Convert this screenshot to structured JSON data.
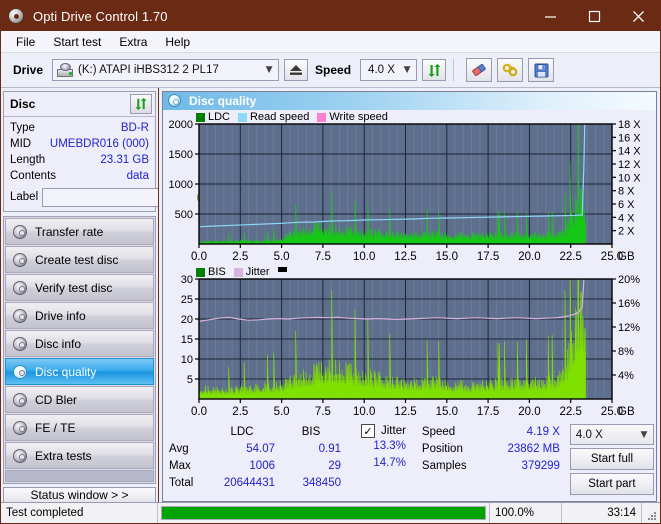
{
  "window": {
    "title": "Opti Drive Control 1.70",
    "title_icon": "disc-icon",
    "minimize": "–",
    "maximize": "□",
    "close": "✕",
    "titlebar_color": "#6b2a14"
  },
  "menu": {
    "items": [
      {
        "label": "File"
      },
      {
        "label": "Start test"
      },
      {
        "label": "Extra"
      },
      {
        "label": "Help"
      }
    ]
  },
  "toolbar": {
    "drive_label": "Drive",
    "drive_value": "(K:)  ATAPI iHBS312  2 PL17",
    "eject_icon": "eject-icon",
    "speed_label": "Speed",
    "speed_value": "4.0 X",
    "refresh_icon": "refresh-icon",
    "eraser_icon": "eraser-icon",
    "keys_icon": "keys-icon",
    "save_icon": "save-icon"
  },
  "disc_panel": {
    "header": "Disc",
    "refresh_icon": "refresh-icon",
    "rows": [
      {
        "key": "Type",
        "value": "BD-R"
      },
      {
        "key": "MID",
        "value": "UMEBDR016 (000)"
      },
      {
        "key": "Length",
        "value": "23.31 GB"
      },
      {
        "key": "Contents",
        "value": "data"
      }
    ],
    "label_key": "Label",
    "label_value": "",
    "label_placeholder": "",
    "disc_button_icon": "cd-icon"
  },
  "nav": {
    "items": [
      {
        "label": "Transfer rate",
        "icon": "disc-icon",
        "active": false
      },
      {
        "label": "Create test disc",
        "icon": "disc-icon",
        "active": false
      },
      {
        "label": "Verify test disc",
        "icon": "disc-icon",
        "active": false
      },
      {
        "label": "Drive info",
        "icon": "disc-icon",
        "active": false
      },
      {
        "label": "Disc info",
        "icon": "disc-icon",
        "active": false
      },
      {
        "label": "Disc quality",
        "icon": "disc-icon",
        "active": true
      },
      {
        "label": "CD Bler",
        "icon": "disc-icon",
        "active": false
      },
      {
        "label": "FE / TE",
        "icon": "disc-icon",
        "active": false
      },
      {
        "label": "Extra tests",
        "icon": "disc-icon",
        "active": false
      }
    ],
    "status_window_button": "Status window > >"
  },
  "main": {
    "panel_title": "Disc quality",
    "panel_icon": "disc-icon"
  },
  "stats": {
    "col_headers": [
      "LDC",
      "BIS"
    ],
    "row_labels": [
      "Avg",
      "Max",
      "Total"
    ],
    "ldc": {
      "avg": "54.07",
      "max": "1006",
      "total": "20644431"
    },
    "bis": {
      "avg": "0.91",
      "max": "29",
      "total": "348450"
    },
    "jitter": {
      "checkbox_label": "Jitter",
      "checked": true,
      "check_glyph": "✓",
      "avg": "13.3%",
      "max": "14.7%"
    },
    "speed_key": "Speed",
    "speed_value": "4.19 X",
    "position_key": "Position",
    "position_value": "23862 MB",
    "samples_key": "Samples",
    "samples_value": "379299",
    "speed_select": "4.0 X",
    "start_full_button": "Start full",
    "start_part_button": "Start part"
  },
  "statusbar": {
    "message": "Test completed",
    "progress_percent": 100.0,
    "progress_text": "100.0%",
    "elapsed": "33:14",
    "progress_color": "#00a400"
  },
  "chart_data": [
    {
      "id": "ldc-chart",
      "type": "area",
      "title": "",
      "xlabel": "GB",
      "ylabel": "",
      "xlim": [
        0,
        25.0
      ],
      "xticks": [
        "0.0",
        "2.5",
        "5.0",
        "7.5",
        "10.0",
        "12.5",
        "15.0",
        "17.5",
        "20.0",
        "22.5",
        "25.0"
      ],
      "xtick_values": [
        0,
        2.5,
        5,
        7.5,
        10,
        12.5,
        15,
        17.5,
        20,
        22.5,
        25
      ],
      "x_unit": "GB",
      "ylim": [
        0,
        2000
      ],
      "yticks": [
        "500",
        "1000",
        "1500",
        "2000"
      ],
      "ytick_values": [
        500,
        1000,
        1500,
        2000
      ],
      "y2lim": [
        0,
        18
      ],
      "y2ticks": [
        "2 X",
        "4 X",
        "6 X",
        "8 X",
        "10 X",
        "12 X",
        "14 X",
        "16 X",
        "18 X"
      ],
      "y2tick_values": [
        2,
        4,
        6,
        8,
        10,
        12,
        14,
        16,
        18
      ],
      "grid": true,
      "plot_bg": "#5e6f8e",
      "legend_position": "top-left",
      "legend": [
        {
          "name": "LDC",
          "color": "#008000"
        },
        {
          "name": "Read speed",
          "color": "#8ed8f8"
        },
        {
          "name": "Write speed",
          "color": "#ff7fd4"
        }
      ],
      "series": [
        {
          "name": "LDC",
          "color": "#16c816",
          "kind": "area",
          "x": [
            0.0,
            0.4,
            0.8,
            1.2,
            1.7,
            2.1,
            2.5,
            3.0,
            3.4,
            3.8,
            4.2,
            4.6,
            5.0,
            5.2,
            5.5,
            5.9,
            6.3,
            6.7,
            7.1,
            7.5,
            7.9,
            8.3,
            8.7,
            9.1,
            9.5,
            9.9,
            10.3,
            10.7,
            11.1,
            11.5,
            11.9,
            12.3,
            12.7,
            13.1,
            13.5,
            13.9,
            14.3,
            14.7,
            15.1,
            15.5,
            15.9,
            16.3,
            16.7,
            17.1,
            17.5,
            17.9,
            18.3,
            18.7,
            19.1,
            19.5,
            19.9,
            20.3,
            20.7,
            21.1,
            21.5,
            21.9,
            22.1,
            22.3,
            22.5,
            22.7,
            22.9,
            23.1,
            23.3,
            23.4
          ],
          "values": [
            60,
            55,
            62,
            58,
            65,
            60,
            70,
            68,
            72,
            75,
            80,
            88,
            95,
            150,
            200,
            250,
            290,
            330,
            360,
            345,
            330,
            320,
            300,
            285,
            270,
            260,
            250,
            240,
            235,
            230,
            225,
            220,
            218,
            215,
            212,
            210,
            208,
            206,
            205,
            203,
            202,
            200,
            200,
            198,
            197,
            196,
            195,
            195,
            194,
            193,
            193,
            192,
            192,
            195,
            200,
            230,
            280,
            380,
            520,
            700,
            880,
            990,
            1006,
            600
          ]
        },
        {
          "name": "Read speed",
          "color": "#8ed8f8",
          "kind": "line",
          "x": [
            0.0,
            1.0,
            2.0,
            3.0,
            4.0,
            5.0,
            6.0,
            7.0,
            8.0,
            9.0,
            10.0,
            11.0,
            12.0,
            13.0,
            14.0,
            15.0,
            16.0,
            17.0,
            18.0,
            19.0,
            20.0,
            21.0,
            22.0,
            22.8,
            23.2,
            23.3,
            23.35
          ],
          "values": [
            2.6,
            2.7,
            2.8,
            2.9,
            3.0,
            3.1,
            3.25,
            3.3,
            3.45,
            3.5,
            3.6,
            3.65,
            3.7,
            3.75,
            3.85,
            3.9,
            3.95,
            4.0,
            4.05,
            4.1,
            4.15,
            4.2,
            4.25,
            4.3,
            4.35,
            12.0,
            18.0
          ]
        },
        {
          "name": "Write speed",
          "color": "#ff7fd4",
          "kind": "line",
          "x": [],
          "values": []
        }
      ]
    },
    {
      "id": "bis-jitter-chart",
      "type": "area",
      "title": "",
      "xlabel": "GB",
      "ylabel": "",
      "xlim": [
        0,
        25.0
      ],
      "xticks": [
        "0.0",
        "2.5",
        "5.0",
        "7.5",
        "10.0",
        "12.5",
        "15.0",
        "17.5",
        "20.0",
        "22.5",
        "25.0"
      ],
      "xtick_values": [
        0,
        2.5,
        5,
        7.5,
        10,
        12.5,
        15,
        17.5,
        20,
        22.5,
        25
      ],
      "x_unit": "GB",
      "ylim": [
        0,
        30
      ],
      "yticks": [
        "5",
        "10",
        "15",
        "20",
        "25",
        "30"
      ],
      "ytick_values": [
        5,
        10,
        15,
        20,
        25,
        30
      ],
      "y2lim": [
        0,
        20
      ],
      "y2ticks": [
        "4%",
        "8%",
        "12%",
        "16%",
        "20%"
      ],
      "y2tick_values": [
        4,
        8,
        12,
        16,
        20
      ],
      "grid": true,
      "plot_bg": "#5e6f8e",
      "legend_position": "top-left",
      "legend": [
        {
          "name": "BIS",
          "color": "#008000"
        },
        {
          "name": "Jitter",
          "color": "#d9b3e0"
        },
        {
          "name": "marker",
          "color": "#000000"
        }
      ],
      "series": [
        {
          "name": "BIS",
          "color": "#7fe000",
          "kind": "area",
          "x": [
            0.0,
            0.5,
            1.0,
            1.5,
            2.0,
            2.5,
            3.0,
            3.5,
            4.0,
            4.5,
            5.0,
            5.5,
            6.0,
            6.5,
            7.0,
            7.5,
            8.0,
            8.5,
            9.0,
            9.5,
            10.0,
            10.5,
            11.0,
            11.5,
            12.0,
            12.5,
            13.0,
            13.5,
            14.0,
            14.5,
            15.0,
            15.5,
            16.0,
            16.5,
            17.0,
            17.5,
            18.0,
            18.5,
            19.0,
            19.5,
            20.0,
            20.5,
            21.0,
            21.5,
            21.9,
            22.1,
            22.3,
            22.5,
            22.7,
            22.9,
            23.05,
            23.2,
            23.3,
            23.4
          ],
          "values": [
            3.0,
            3.2,
            3.0,
            2.8,
            3.0,
            3.2,
            3.5,
            3.8,
            4.0,
            4.2,
            4.5,
            5.5,
            6.5,
            7.5,
            8.5,
            9.5,
            10.0,
            9.8,
            9.0,
            8.0,
            7.5,
            7.0,
            6.5,
            6.0,
            5.8,
            5.5,
            5.3,
            5.2,
            5.5,
            5.3,
            5.0,
            4.8,
            4.5,
            4.3,
            4.5,
            4.8,
            5.0,
            5.2,
            5.0,
            5.3,
            5.5,
            5.2,
            5.5,
            6.0,
            7.0,
            9.0,
            12.0,
            16.0,
            21.0,
            26.0,
            28.5,
            29.0,
            29.0,
            28.0
          ]
        },
        {
          "name": "Jitter",
          "color": "#d9b3e0",
          "kind": "line",
          "x": [
            0.0,
            0.6,
            1.2,
            1.8,
            2.4,
            3.0,
            3.6,
            4.2,
            4.8,
            5.4,
            6.0,
            6.6,
            7.2,
            7.8,
            8.4,
            9.0,
            9.6,
            10.2,
            10.8,
            11.4,
            12.0,
            12.6,
            13.2,
            13.8,
            14.4,
            15.0,
            15.6,
            16.2,
            16.8,
            17.4,
            18.0,
            18.6,
            19.2,
            19.8,
            20.4,
            21.0,
            21.6,
            22.0,
            22.4,
            22.8,
            23.0,
            23.2,
            23.3
          ],
          "values": [
            19.4,
            19.8,
            20.2,
            20.4,
            20.0,
            19.7,
            19.8,
            20.0,
            20.1,
            20.0,
            20.2,
            20.3,
            20.4,
            20.3,
            20.4,
            20.2,
            20.1,
            20.0,
            20.1,
            20.0,
            19.9,
            20.0,
            20.1,
            20.2,
            20.3,
            20.2,
            20.1,
            20.2,
            20.3,
            20.2,
            20.1,
            20.2,
            20.3,
            20.2,
            20.1,
            20.2,
            20.3,
            20.5,
            20.8,
            21.3,
            21.8,
            23.0,
            30.0
          ]
        }
      ]
    }
  ]
}
